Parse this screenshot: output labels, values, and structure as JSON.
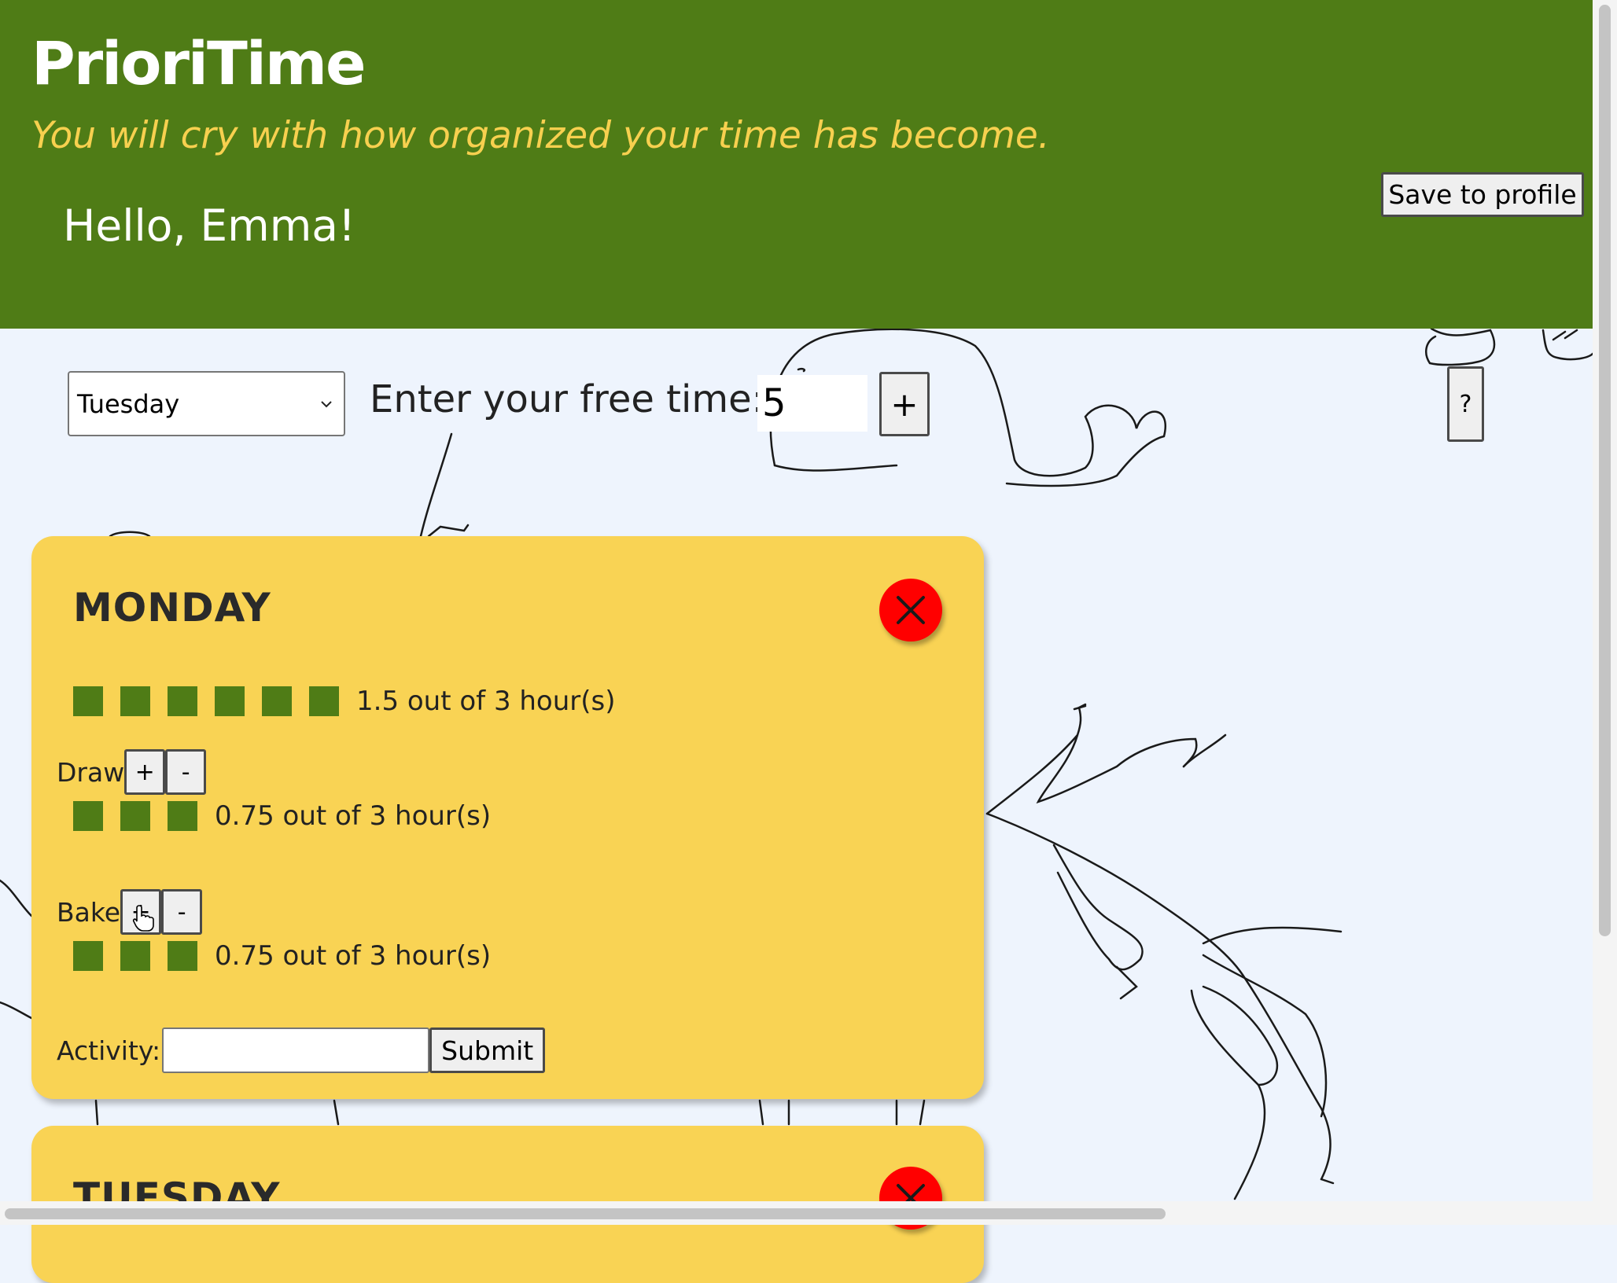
{
  "header": {
    "app_title": "PrioriTime",
    "tagline": "You will cry with how organized your time has become.",
    "greeting": "Hello, Emma!",
    "save_label": "Save to profile",
    "background_color": "#4f7c16",
    "tagline_color": "#f7d04f"
  },
  "controls": {
    "day_select_value": "Tuesday",
    "free_time_label": "Enter your free time:",
    "free_time_value": "5",
    "add_label": "+",
    "help_label": "?"
  },
  "days": [
    {
      "title": "MONDAY",
      "summary": {
        "blocks": 6,
        "text": "1.5 out of 3 hour(s)"
      },
      "activities": [
        {
          "name": "Draw",
          "plus": "+",
          "minus": "-",
          "blocks": 3,
          "text": "0.75 out of 3 hour(s)"
        },
        {
          "name": "Bake",
          "plus": "+",
          "minus": "-",
          "blocks": 3,
          "text": "0.75 out of 3 hour(s)"
        }
      ],
      "form": {
        "label": "Activity:",
        "input_value": "",
        "submit_label": "Submit"
      }
    },
    {
      "title": "TUESDAY"
    }
  ],
  "colors": {
    "card": "#f9d354",
    "block": "#4f7c16",
    "close": "#ff0000",
    "page_background": "#eef4fd"
  },
  "icons": [
    "chevron-down-icon",
    "close-icon",
    "pointer-cursor-icon"
  ]
}
